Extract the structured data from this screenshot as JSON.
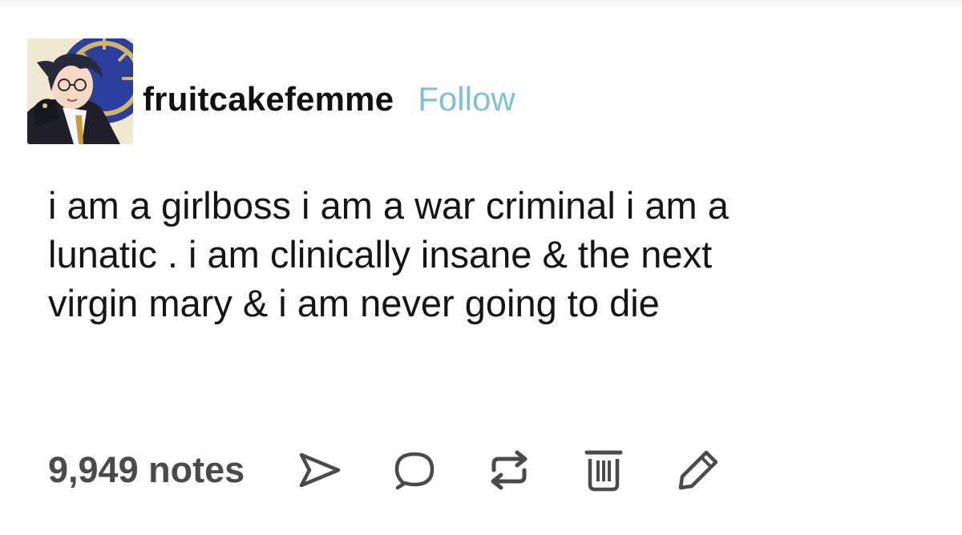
{
  "post": {
    "username": "fruitcakefemme",
    "follow_label": "Follow",
    "body_lines": [
      "i am a girlboss i am a war criminal i am a",
      "lunatic . i am clinically insane & the next",
      "virgin mary & i am never going to die"
    ],
    "notes_label": "9,949 notes"
  },
  "icons": {
    "share": "share-icon",
    "reply": "reply-icon",
    "reblog": "reblog-icon",
    "delete": "delete-icon",
    "edit": "edit-icon"
  },
  "colors": {
    "follow": "#7ec0d6",
    "icons": "#4a4a4a",
    "text": "#151515"
  }
}
